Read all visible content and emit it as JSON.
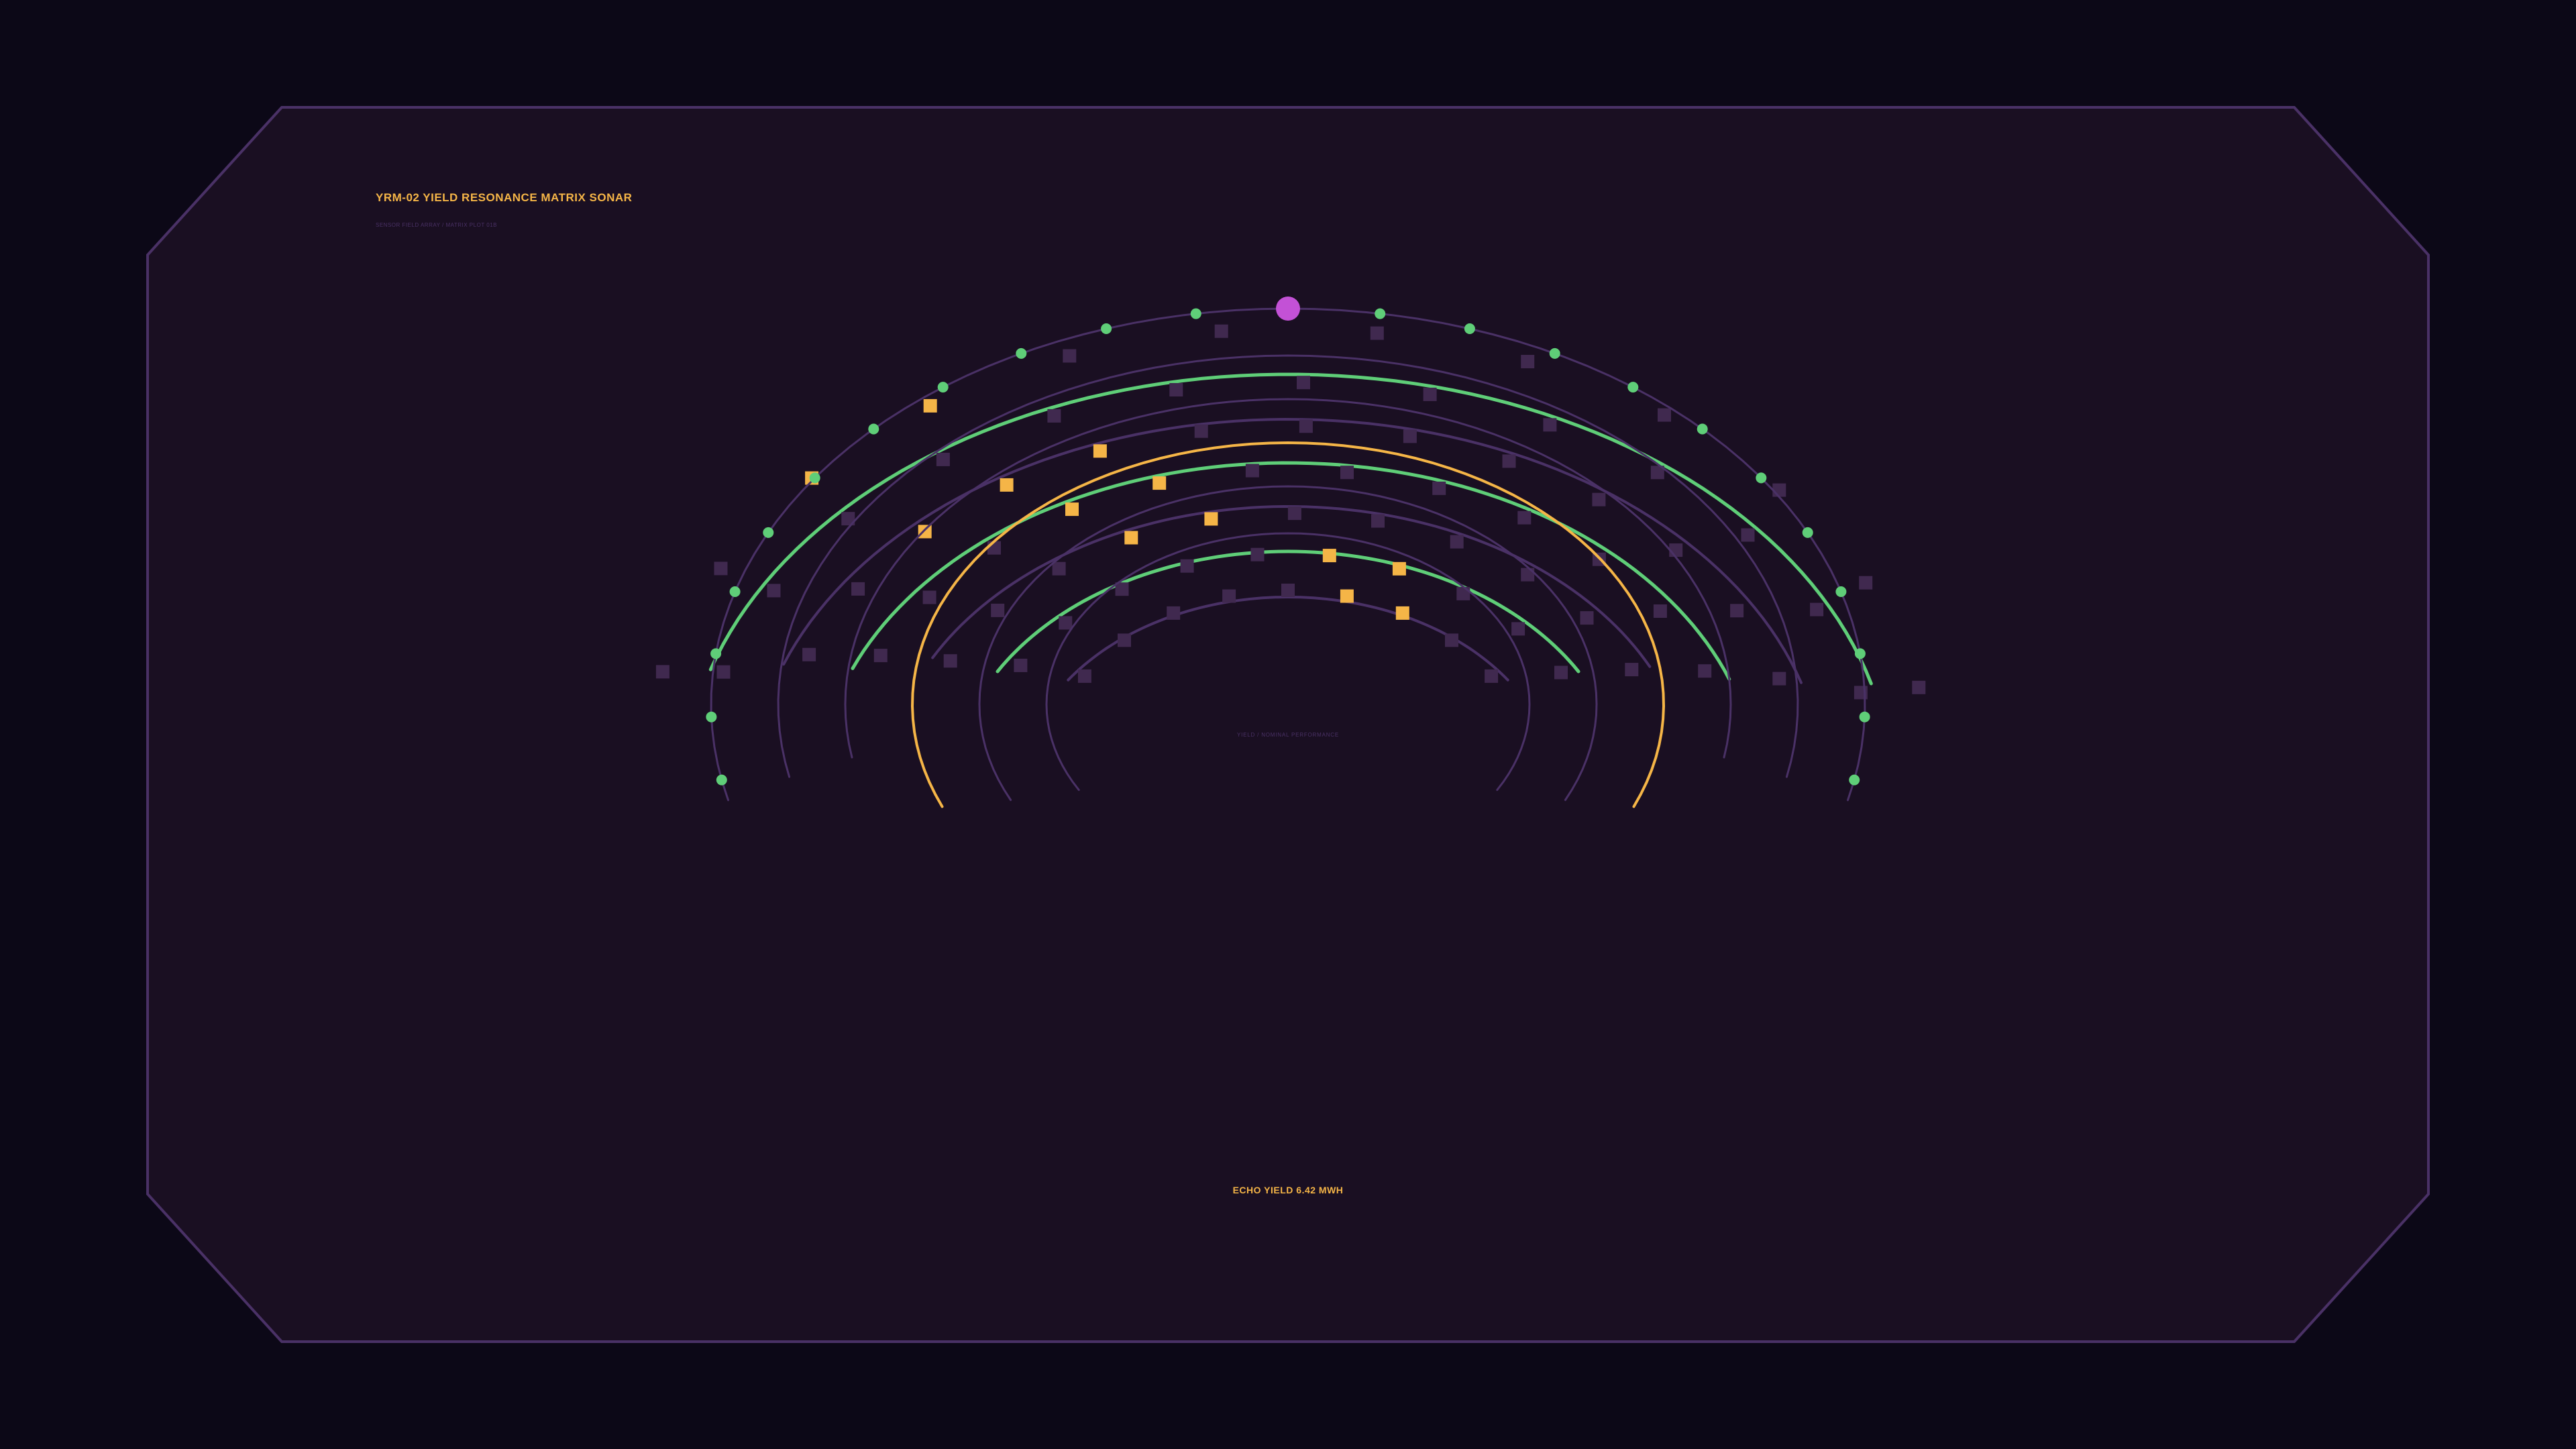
{
  "header": {
    "title": "YRM-02  YIELD RESONANCE MATRIX SONAR",
    "subtitle": "SENSOR FIELD ARRAY / MATRIX PLOT 01B"
  },
  "center_label": "YIELD / NOMINAL PERFORMANCE",
  "footer": {
    "yield_label": "ECHO YIELD 6.42 MWH"
  },
  "colors": {
    "background": "#0c0817",
    "panel": "#1a0f22",
    "border": "#4a3166",
    "dim_arc": "#4a3166",
    "green": "#5fce78",
    "amber": "#f5b547",
    "cell": "#40294f",
    "magenta": "#c351d6"
  }
}
